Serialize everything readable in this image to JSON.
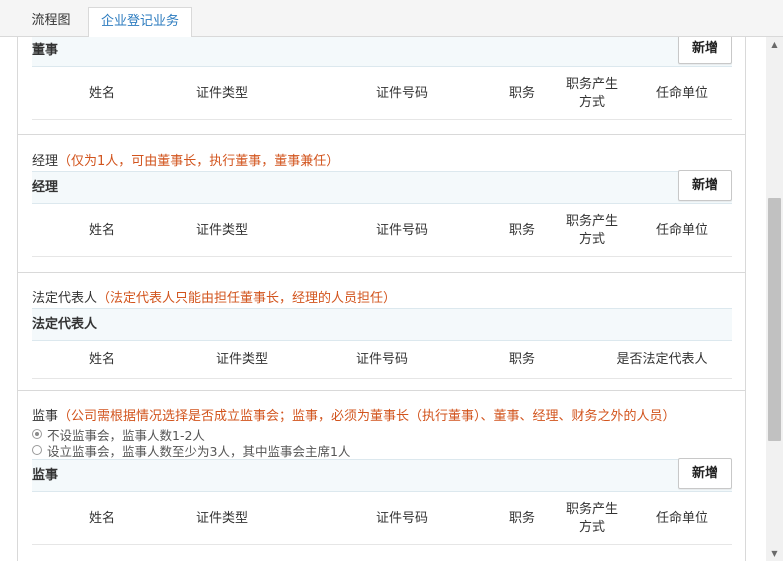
{
  "tabs": [
    {
      "label": "流程图"
    },
    {
      "label": "企业登记业务"
    }
  ],
  "active_tab_color": "#2b7bbf",
  "note_color": "#d2541d",
  "buttons": {
    "add_label": "新增"
  },
  "sections": {
    "directors": {
      "bar_title": "董事",
      "columns": [
        "姓名",
        "证件类型",
        "证件号码",
        "职务",
        "职务产生方式",
        "任命单位"
      ]
    },
    "manager": {
      "title": "经理",
      "note": "（仅为1人，可由董事长，执行董事，董事兼任）",
      "bar_title": "经理",
      "columns": [
        "姓名",
        "证件类型",
        "证件号码",
        "职务",
        "职务产生方式",
        "任命单位"
      ]
    },
    "legal_rep": {
      "title": "法定代表人",
      "note": "（法定代表人只能由担任董事长，经理的人员担任）",
      "bar_title": "法定代表人",
      "columns": [
        "姓名",
        "证件类型",
        "证件号码",
        "职务",
        "是否法定代表人"
      ]
    },
    "supervisors": {
      "title": "监事",
      "note": "（公司需根据情况选择是否成立监事会；监事，必须为董事长（执行董事）、董事、经理、财务之外的人员）",
      "options": [
        {
          "label": "不设监事会，监事人数1-2人",
          "checked": true
        },
        {
          "label": "设立监事会，监事人数至少为3人，其中监事会主席1人",
          "checked": false
        }
      ],
      "bar_title": "监事",
      "columns": [
        "姓名",
        "证件类型",
        "证件号码",
        "职务",
        "职务产生方式",
        "任命单位"
      ]
    }
  }
}
